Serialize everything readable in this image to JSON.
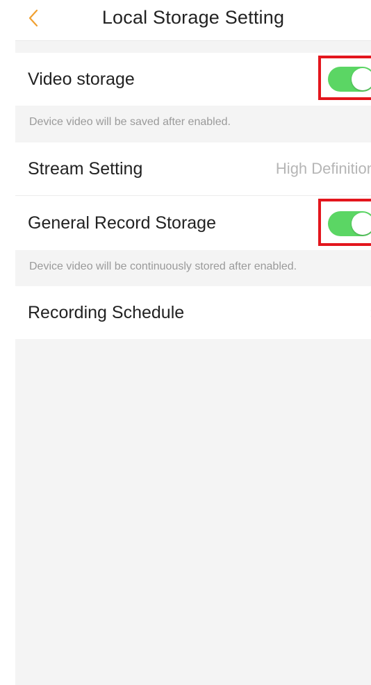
{
  "header": {
    "title": "Local Storage Setting",
    "back_icon": "chevron-left-icon",
    "accent_color": "#f0a030"
  },
  "settings": {
    "video_storage": {
      "label": "Video storage",
      "enabled": true,
      "hint": "Device video will be saved after enabled."
    },
    "stream_setting": {
      "label": "Stream Setting",
      "value": "High Definition"
    },
    "general_record_storage": {
      "label": "General Record Storage",
      "enabled": true,
      "hint": "Device video will be continuously stored after enabled."
    },
    "recording_schedule": {
      "label": "Recording Schedule"
    }
  },
  "colors": {
    "toggle_on": "#5bd664",
    "highlight_border": "#e3161d",
    "background": "#f4f4f4"
  }
}
